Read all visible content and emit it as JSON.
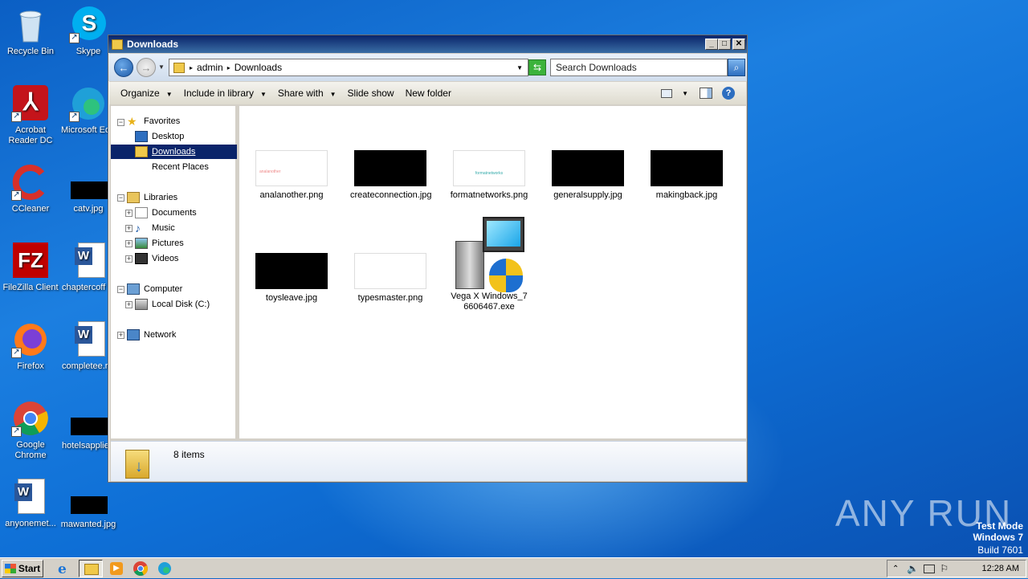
{
  "desktop": {
    "icons": [
      {
        "label": "Recycle Bin"
      },
      {
        "label": "Skype"
      },
      {
        "label": "Acrobat Reader DC"
      },
      {
        "label": "Microsoft Ed"
      },
      {
        "label": "CCleaner"
      },
      {
        "label": "catv.jpg"
      },
      {
        "label": "FileZilla Client"
      },
      {
        "label": "chaptercoff"
      },
      {
        "label": "Firefox"
      },
      {
        "label": "completee.r"
      },
      {
        "label": "Google Chrome"
      },
      {
        "label": "hotelsapplie"
      },
      {
        "label": "anyonemet..."
      },
      {
        "label": "mawanted.jpg"
      }
    ],
    "watermark_brand": "ANY RUN",
    "os_notice": {
      "line1": "Test Mode",
      "line2": "Windows 7",
      "line3": "Build 7601"
    }
  },
  "window": {
    "title": "Downloads",
    "controls": {
      "minimize": "_",
      "maximize": "□",
      "close": "✕"
    },
    "breadcrumb": [
      "admin",
      "Downloads"
    ],
    "search_placeholder": "Search Downloads",
    "toolbar": {
      "organize": "Organize",
      "include_in_library": "Include in library",
      "share_with": "Share with",
      "slide_show": "Slide show",
      "new_folder": "New folder"
    },
    "nav": {
      "favorites": "Favorites",
      "desktop": "Desktop",
      "downloads": "Downloads",
      "recent_places": "Recent Places",
      "libraries": "Libraries",
      "documents": "Documents",
      "music": "Music",
      "pictures": "Pictures",
      "videos": "Videos",
      "computer": "Computer",
      "local_disk": "Local Disk (C:)",
      "network": "Network"
    },
    "files": [
      {
        "name": "analanother.png",
        "thumb_text": "analanother"
      },
      {
        "name": "createconnection.jpg"
      },
      {
        "name": "formatnetworks.png",
        "thumb_text": "formatnetworks"
      },
      {
        "name": "generalsupply.jpg"
      },
      {
        "name": "makingback.jpg"
      },
      {
        "name": "toysleave.jpg"
      },
      {
        "name": "typesmaster.png"
      },
      {
        "name": "Vega X Windows_76606467.exe"
      }
    ],
    "status": {
      "item_count": "8 items"
    }
  },
  "taskbar": {
    "start_label": "Start",
    "clock": "12:28 AM"
  },
  "colors": {
    "accent": "#0a246a",
    "selection": "#0a246a",
    "desktop": "#1c7fe0"
  }
}
